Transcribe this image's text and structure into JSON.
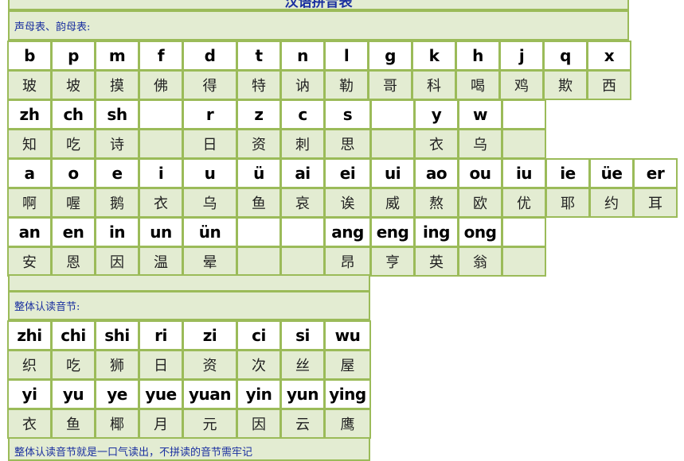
{
  "title": "汉语拼音表",
  "section1_label": "声母表、韵母表:",
  "section2_label": "整体认读音节:",
  "footer_note": "整体认读音节就是一口气读出，不拼读的音节需牢记",
  "shengmu_1": {
    "pinyin": [
      "b",
      "p",
      "m",
      "f",
      "d",
      "t",
      "n",
      "l",
      "g",
      "k",
      "h",
      "j",
      "q",
      "x"
    ],
    "hanzi": [
      "玻",
      "坡",
      "摸",
      "佛",
      "得",
      "特",
      "讷",
      "勒",
      "哥",
      "科",
      "喝",
      "鸡",
      "欺",
      "西"
    ]
  },
  "shengmu_2": {
    "pinyin": [
      "zh",
      "ch",
      "sh",
      "",
      "r",
      "z",
      "c",
      "s",
      "",
      "y",
      "w",
      ""
    ],
    "hanzi": [
      "知",
      "吃",
      "诗",
      "",
      "日",
      "资",
      "刺",
      "思",
      "",
      "衣",
      "乌",
      ""
    ]
  },
  "yunmu_1": {
    "pinyin": [
      "a",
      "o",
      "e",
      "i",
      "u",
      "ü",
      "ai",
      "ei",
      "ui",
      "ao",
      "ou",
      "iu",
      "ie",
      "üe",
      "er"
    ],
    "hanzi": [
      "啊",
      "喔",
      "鹅",
      "衣",
      "乌",
      "鱼",
      "哀",
      "诶",
      "威",
      "熬",
      "欧",
      "优",
      "耶",
      "约",
      "耳"
    ]
  },
  "yunmu_2": {
    "pinyin": [
      "an",
      "en",
      "in",
      "un",
      "ün",
      "",
      "",
      "ang",
      "eng",
      "ing",
      "ong",
      ""
    ],
    "hanzi": [
      "安",
      "恩",
      "因",
      "温",
      "晕",
      "",
      "",
      "昂",
      "亨",
      "英",
      "翁",
      ""
    ]
  },
  "zhengti_1": {
    "pinyin": [
      "zhi",
      "chi",
      "shi",
      "ri",
      "zi",
      "ci",
      "si",
      "wu"
    ],
    "hanzi": [
      "织",
      "吃",
      "狮",
      "日",
      "资",
      "次",
      "丝",
      "屋"
    ]
  },
  "zhengti_2": {
    "pinyin": [
      "yi",
      "yu",
      "ye",
      "yue",
      "yuan",
      "yin",
      "yun",
      "ying"
    ],
    "hanzi": [
      "衣",
      "鱼",
      "椰",
      "月",
      "元",
      "因",
      "云",
      "鹰"
    ]
  }
}
